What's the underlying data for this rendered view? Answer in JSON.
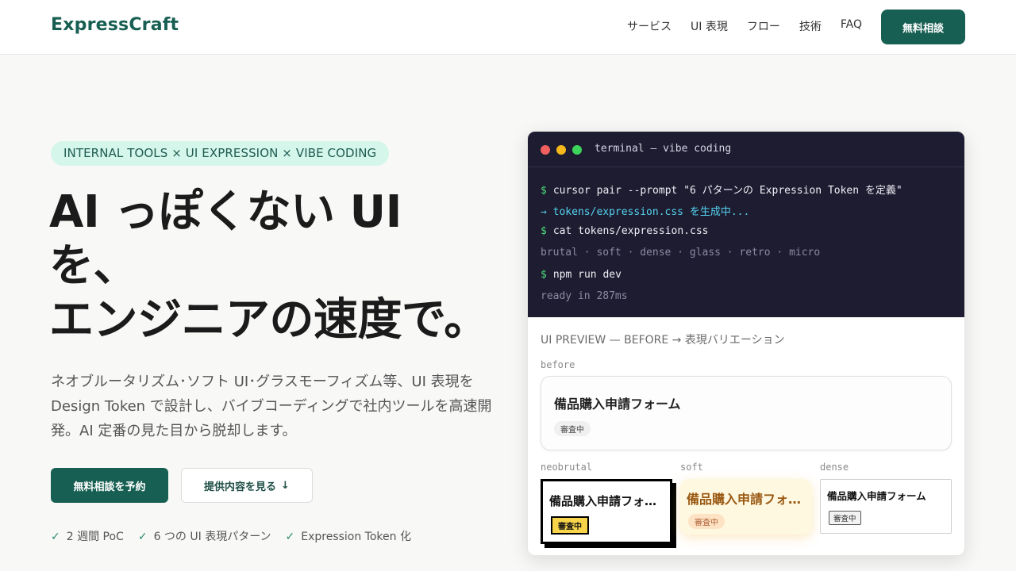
{
  "header": {
    "logo": "ExpressCraft",
    "nav": [
      "サービス",
      "UI 表現",
      "フロー",
      "技術",
      "FAQ"
    ],
    "cta": "無料相談"
  },
  "hero": {
    "pill": "INTERNAL TOOLS × UI EXPRESSION × VIBE CODING",
    "headline": [
      "AI っぽくない UI",
      "を、",
      "エンジニアの速度で。"
    ],
    "lead": "ネオブルータリズム･ソフト UI･グラスモーフィズム等、UI 表現を Design Token で設計し、バイブコーディングで社内ツールを高速開発。AI 定番の見た目から脱却します。",
    "primary_button": "無料相談を予約",
    "secondary_button": "提供内容を見る",
    "features": [
      "2 週間 PoC",
      "6 つの UI 表現パターン",
      "Expression Token 化"
    ]
  },
  "terminal": {
    "title": "terminal — vibe coding",
    "lines": [
      {
        "prompt": "$",
        "text": "cursor pair --prompt \"6 パターンの Expression Token を定義\""
      },
      {
        "text": "→ tokens/expression.css を生成中..."
      },
      {
        "prompt": "$",
        "text": "cat tokens/expression.css"
      },
      {
        "text": "brutal · soft · dense · glass · retro · micro"
      },
      {
        "prompt": "$",
        "text": "npm run dev"
      },
      {
        "text": "ready in 287ms"
      }
    ]
  },
  "preview": {
    "title": "UI PREVIEW — BEFORE → 表現バリエーション",
    "before_label": "before",
    "form_title": "備品購入申請フォーム",
    "badge": "審査中",
    "variants": [
      {
        "label": "neobrutal",
        "title": "備品購入申請フォーム",
        "badge": "審査中"
      },
      {
        "label": "soft",
        "title": "備品購入申請フォーム",
        "badge": "審査中"
      },
      {
        "label": "dense",
        "title": "備品購入申請フォーム",
        "badge": "審査中"
      }
    ]
  },
  "colors": {
    "brand": "#175f52",
    "pill_bg": "#d5f6ea",
    "terminal_bg": "#1e1c30"
  },
  "icons": {
    "secondary_button": "arrow-down-icon",
    "features": "check-icon"
  }
}
